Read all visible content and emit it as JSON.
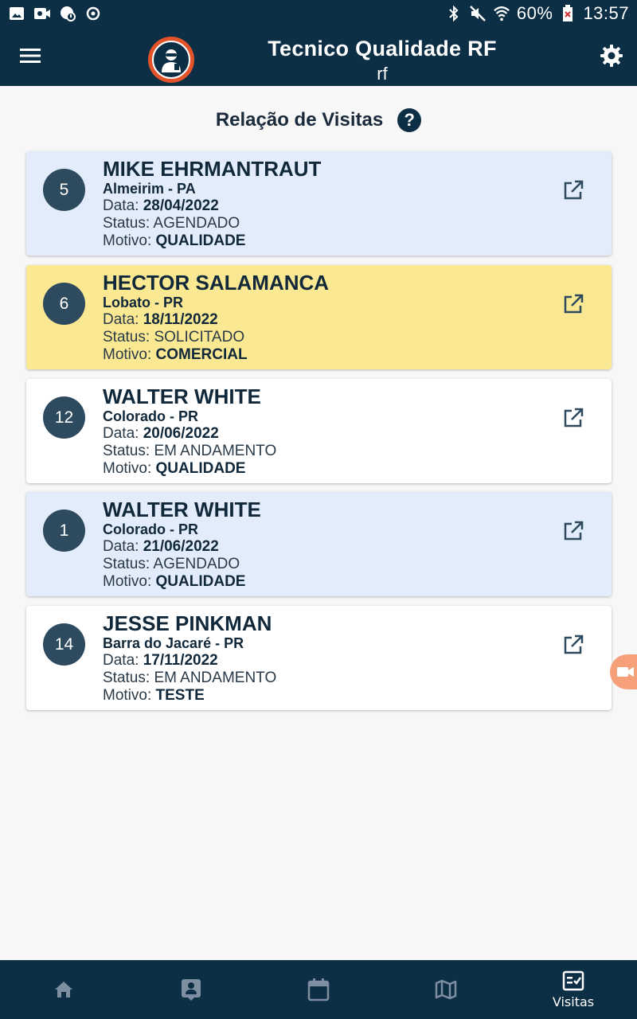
{
  "status_bar": {
    "battery": "60%",
    "time": "13:57"
  },
  "app_bar": {
    "title": "Tecnico Qualidade RF",
    "subtitle": "rf"
  },
  "heading": "Relação de Visitas",
  "labels": {
    "data": "Data:",
    "status": "Status:",
    "motivo": "Motivo:"
  },
  "visits": [
    {
      "number": "5",
      "name": "MIKE EHRMANTRAUT",
      "city": "Almeirim - PA",
      "date": "28/04/2022",
      "status": "AGENDADO",
      "reason": "QUALIDADE",
      "color": "#e2ecfa"
    },
    {
      "number": "6",
      "name": "HECTOR SALAMANCA",
      "city": "Lobato - PR",
      "date": "18/11/2022",
      "status": "SOLICITADO",
      "reason": "COMERCIAL",
      "color": "#fbe892"
    },
    {
      "number": "12",
      "name": "WALTER WHITE",
      "city": "Colorado - PR",
      "date": "20/06/2022",
      "status": "EM ANDAMENTO",
      "reason": "QUALIDADE",
      "color": "#ffffff"
    },
    {
      "number": "1",
      "name": "WALTER WHITE",
      "city": "Colorado - PR",
      "date": "21/06/2022",
      "status": "AGENDADO",
      "reason": "QUALIDADE",
      "color": "#e2ecfa"
    },
    {
      "number": "14",
      "name": "JESSE PINKMAN",
      "city": "Barra do Jacaré - PR",
      "date": "17/11/2022",
      "status": "EM ANDAMENTO",
      "reason": "TESTE",
      "color": "#ffffff"
    }
  ],
  "bottom_nav": {
    "items": [
      {
        "icon": "home-icon",
        "label": ""
      },
      {
        "icon": "contact-icon",
        "label": ""
      },
      {
        "icon": "calendar-icon",
        "label": ""
      },
      {
        "icon": "map-icon",
        "label": ""
      },
      {
        "icon": "checklist-icon",
        "label": "Visitas"
      }
    ]
  },
  "colors": {
    "primary": "#0d2f45",
    "accent": "#e2532a",
    "badge": "#2d4a5e"
  }
}
